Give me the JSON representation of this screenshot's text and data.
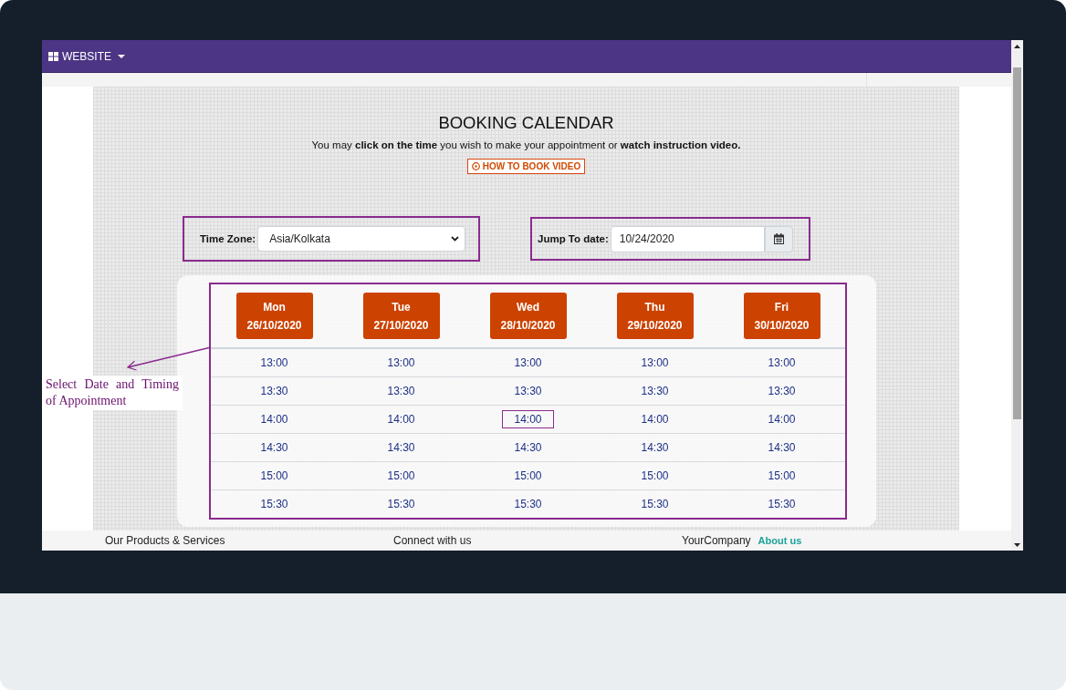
{
  "nav": {
    "menu_label": "WEBSITE"
  },
  "page": {
    "title": "BOOKING CALENDAR",
    "intro": "You may **click on the time** you wish to make your appointment or **watch instruction video.**",
    "video_button": "HOW TO BOOK VIDEO"
  },
  "filters": {
    "time_zone": {
      "label": "Time Zone:",
      "value": "Asia/Kolkata"
    },
    "jump_to_date": {
      "label": "Jump To date:",
      "value": "10/24/2020"
    }
  },
  "calendar": {
    "days": [
      {
        "weekday": "Mon",
        "date": "26/10/2020",
        "slots": [
          {
            "time": "13:00",
            "selected": false
          },
          {
            "time": "13:30",
            "selected": false
          },
          {
            "time": "14:00",
            "selected": false
          },
          {
            "time": "14:30",
            "selected": false
          },
          {
            "time": "15:00",
            "selected": false
          },
          {
            "time": "15:30",
            "selected": false
          }
        ]
      },
      {
        "weekday": "Tue",
        "date": "27/10/2020",
        "slots": [
          {
            "time": "13:00",
            "selected": false
          },
          {
            "time": "13:30",
            "selected": false
          },
          {
            "time": "14:00",
            "selected": false
          },
          {
            "time": "14:30",
            "selected": false
          },
          {
            "time": "15:00",
            "selected": false
          },
          {
            "time": "15:30",
            "selected": false
          }
        ]
      },
      {
        "weekday": "Wed",
        "date": "28/10/2020",
        "slots": [
          {
            "time": "13:00",
            "selected": false
          },
          {
            "time": "13:30",
            "selected": false
          },
          {
            "time": "14:00",
            "selected": true
          },
          {
            "time": "14:30",
            "selected": false
          },
          {
            "time": "15:00",
            "selected": false
          },
          {
            "time": "15:30",
            "selected": false
          }
        ]
      },
      {
        "weekday": "Thu",
        "date": "29/10/2020",
        "slots": [
          {
            "time": "13:00",
            "selected": false
          },
          {
            "time": "13:30",
            "selected": false
          },
          {
            "time": "14:00",
            "selected": false
          },
          {
            "time": "14:30",
            "selected": false
          },
          {
            "time": "15:00",
            "selected": false
          },
          {
            "time": "15:30",
            "selected": false
          }
        ]
      },
      {
        "weekday": "Fri",
        "date": "30/10/2020",
        "slots": [
          {
            "time": "13:00",
            "selected": false
          },
          {
            "time": "13:30",
            "selected": false
          },
          {
            "time": "14:00",
            "selected": false
          },
          {
            "time": "14:30",
            "selected": false
          },
          {
            "time": "15:00",
            "selected": false
          },
          {
            "time": "15:30",
            "selected": false
          }
        ]
      }
    ]
  },
  "annotation": {
    "text": "Select Date and Timing of Appointment"
  },
  "footer": {
    "columns": [
      {
        "heading": "Our Products & Services"
      },
      {
        "heading": "Connect with us"
      },
      {
        "heading": "YourCompany",
        "link": "About us"
      }
    ]
  }
}
